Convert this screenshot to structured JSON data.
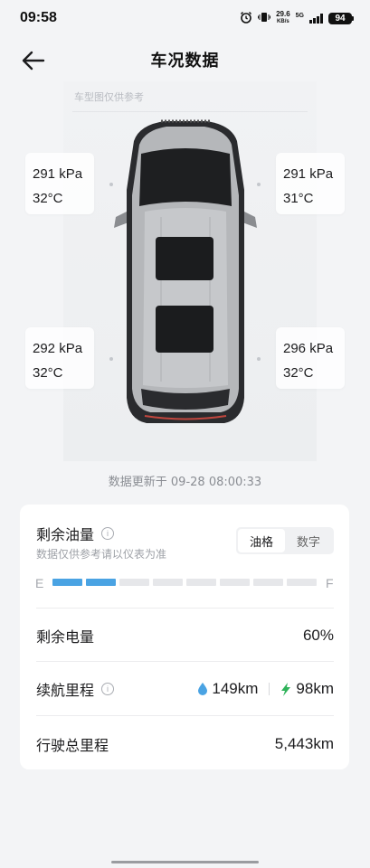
{
  "status_bar": {
    "time": "09:58",
    "net_speed_value": "29.6",
    "net_speed_unit": "KB/s",
    "network": "5G",
    "battery": "94"
  },
  "header": {
    "title": "车况数据"
  },
  "car": {
    "note": "车型图仅供参考",
    "tires": {
      "front_left": {
        "pressure": "291 kPa",
        "temp": "32°C"
      },
      "front_right": {
        "pressure": "291 kPa",
        "temp": "31°C"
      },
      "rear_left": {
        "pressure": "292 kPa",
        "temp": "32°C"
      },
      "rear_right": {
        "pressure": "296 kPa",
        "temp": "32°C"
      }
    }
  },
  "update_time": "数据更新于 09-28 08:00:33",
  "fuel": {
    "title": "剩余油量",
    "note": "数据仅供参考请以仪表为准",
    "toggle": {
      "grid_label": "油格",
      "number_label": "数字",
      "active": "grid"
    },
    "gauge": {
      "empty_label": "E",
      "full_label": "F",
      "filled_segments": 2,
      "total_segments": 8
    }
  },
  "battery_row": {
    "label": "剩余电量",
    "value": "60%"
  },
  "range_row": {
    "label": "续航里程",
    "fuel_range": "149km",
    "electric_range": "98km",
    "colors": {
      "fuel": "#4aa3e3",
      "electric": "#2fb35a"
    }
  },
  "odometer_row": {
    "label": "行驶总里程",
    "value": "5,443km"
  }
}
